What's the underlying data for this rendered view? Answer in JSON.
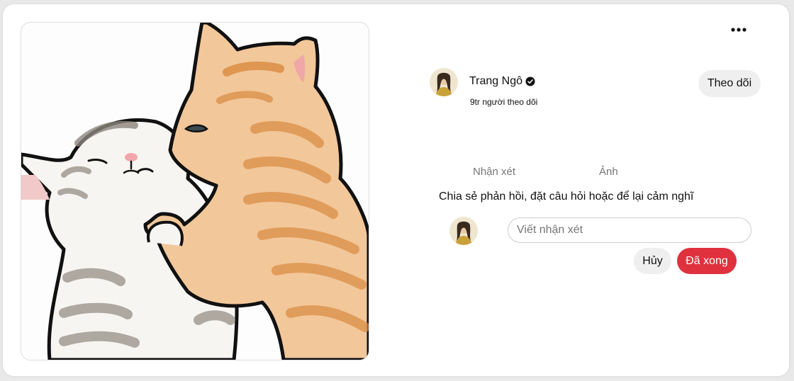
{
  "pin": {
    "image_alt": "Illustration of two cats hugging"
  },
  "menu": {
    "more_icon": "more-horizontal-icon"
  },
  "author": {
    "name": "Trang Ngô",
    "followers": "9tr người theo dõi",
    "verified_icon": "verified-check-icon"
  },
  "follow_label": "Theo dõi",
  "tabs": [
    {
      "label": "Nhận xét"
    },
    {
      "label": "Ảnh"
    }
  ],
  "comments": {
    "prompt": "Chia sẻ phản hồi, đặt câu hỏi hoặc để lại cảm nghĩ",
    "placeholder": "Viết nhận xét",
    "cancel_label": "Hủy",
    "done_label": "Đã xong"
  },
  "colors": {
    "accent": "#e0313f",
    "muted_button": "#efefef"
  }
}
